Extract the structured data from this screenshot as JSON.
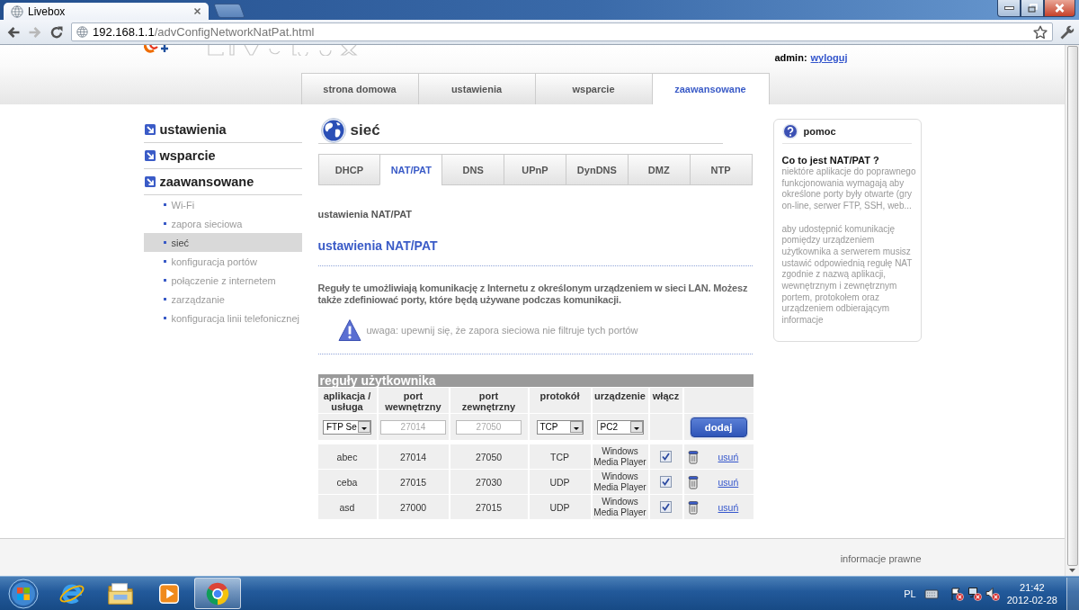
{
  "browser": {
    "tabs": [
      {
        "title": "Livebox",
        "selected": true
      }
    ],
    "forward_disabled": true,
    "url": {
      "host": "192.168.1.1",
      "path": "/advConfigNetworkNatPat.html"
    }
  },
  "header": {
    "user_label": "admin:",
    "logout_link": "wyloguj",
    "tabs": [
      {
        "label": "strona domowa",
        "selected": false
      },
      {
        "label": "ustawienia",
        "selected": false
      },
      {
        "label": "wsparcie",
        "selected": false
      },
      {
        "label": "zaawansowane",
        "selected": true
      }
    ]
  },
  "sidebar": {
    "sections": [
      {
        "label": "ustawienia"
      },
      {
        "label": "wsparcie"
      },
      {
        "label": "zaawansowane",
        "children": [
          {
            "label": "Wi-Fi",
            "selected": false
          },
          {
            "label": "zapora sieciowa",
            "selected": false
          },
          {
            "label": "sieć",
            "selected": true
          },
          {
            "label": "konfiguracja portów",
            "selected": false
          },
          {
            "label": "połączenie z internetem",
            "selected": false
          },
          {
            "label": "zarządzanie",
            "selected": false
          },
          {
            "label": "konfiguracja linii telefonicznej",
            "selected": false
          }
        ]
      }
    ]
  },
  "section": {
    "title": "sieć",
    "tabs": [
      {
        "label": "DHCP",
        "selected": false
      },
      {
        "label": "NAT/PAT",
        "selected": true
      },
      {
        "label": "DNS",
        "selected": false
      },
      {
        "label": "UPnP",
        "selected": false
      },
      {
        "label": "DynDNS",
        "selected": false
      },
      {
        "label": "DMZ",
        "selected": false
      },
      {
        "label": "NTP",
        "selected": false
      }
    ],
    "breadcrumb": "ustawienia NAT/PAT",
    "heading": "ustawienia NAT/PAT",
    "description": "Reguły te umożliwiają komunikację z Internetu z określonym urządzeniem w sieci LAN. Możesz także zdefiniować porty, które będą używane podczas komunikacji.",
    "warning": "uwaga: upewnij się, że zapora sieciowa nie filtruje tych portów"
  },
  "rules_table": {
    "title": "reguły użytkownika",
    "columns": [
      "aplikacja / usługa",
      "port wewnętrzny",
      "port zewnętrzny",
      "protokół",
      "urządzenie",
      "włącz"
    ],
    "new_rule": {
      "application": "FTP Se",
      "internal_port": {
        "placeholder": "27014"
      },
      "external_port": {
        "placeholder": "27050"
      },
      "protocol": "TCP",
      "device": "PC2",
      "add_button": "dodaj"
    },
    "rows": [
      {
        "application": "abec",
        "internal_port": "27014",
        "external_port": "27050",
        "protocol": "TCP",
        "device": "Windows Media Player",
        "enabled": true,
        "delete_link": "usuń"
      },
      {
        "application": "ceba",
        "internal_port": "27015",
        "external_port": "27030",
        "protocol": "UDP",
        "device": "Windows Media Player",
        "enabled": true,
        "delete_link": "usuń"
      },
      {
        "application": "asd",
        "internal_port": "27000",
        "external_port": "27015",
        "protocol": "UDP",
        "device": "Windows Media Player",
        "enabled": true,
        "delete_link": "usuń"
      }
    ]
  },
  "help": {
    "title": "pomoc",
    "question": "Co to jest NAT/PAT ?",
    "paragraphs": [
      "niektóre aplikacje do poprawnego funkcjonowania wymagają aby określone porty były otwarte (gry on-line, serwer FTP, SSH, web...",
      "aby udostępnić komunikację pomiędzy urządzeniem użytkownika a serwerem musisz ustawić odpowiednią regułę NAT zgodnie z nazwą aplikacji, wewnętrznym i zewnętrznym portem, protokołem oraz urządzeniem odbierającym informacje"
    ]
  },
  "footer": {
    "link": "informacje prawne"
  },
  "taskbar": {
    "apps": [
      {
        "kind": "ebrowser",
        "selected": false
      },
      {
        "kind": "folder",
        "selected": false
      },
      {
        "kind": "player",
        "selected": false
      },
      {
        "kind": "rbrowser",
        "selected": true
      }
    ],
    "tray": {
      "language": "PL",
      "time": "21:42",
      "date": "2012-02-28"
    }
  }
}
